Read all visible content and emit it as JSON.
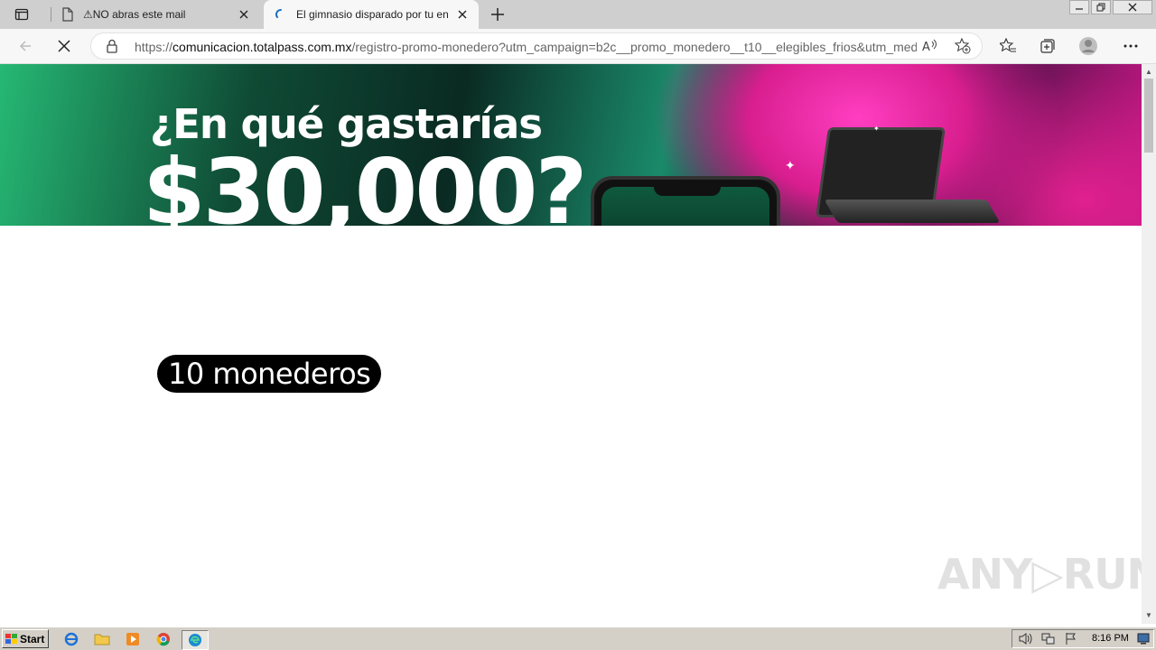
{
  "browser": {
    "tabs": [
      {
        "title": "⚠NO abras este mail",
        "active": false,
        "icon": "page-icon"
      },
      {
        "title": "El gimnasio disparado por tu en",
        "active": true,
        "icon": "loading-spinner-icon"
      }
    ],
    "url_scheme": "https://",
    "url_host": "comunicacion.totalpass.com.mx",
    "url_path": "/registro-promo-monedero?utm_campaign=b2c__promo_monedero__t10__elegibles_frios&utm_med…"
  },
  "page": {
    "banner_question": "¿En qué gastarías",
    "banner_amount": "$30,000?",
    "pill_text": "10 monederos",
    "colors": {
      "pink": "#e0208e",
      "green": "#26b874",
      "dark": "#0a2a22"
    }
  },
  "watermark": "ANY▷RUN",
  "taskbar": {
    "start_label": "Start",
    "clock": "8:16 PM"
  }
}
